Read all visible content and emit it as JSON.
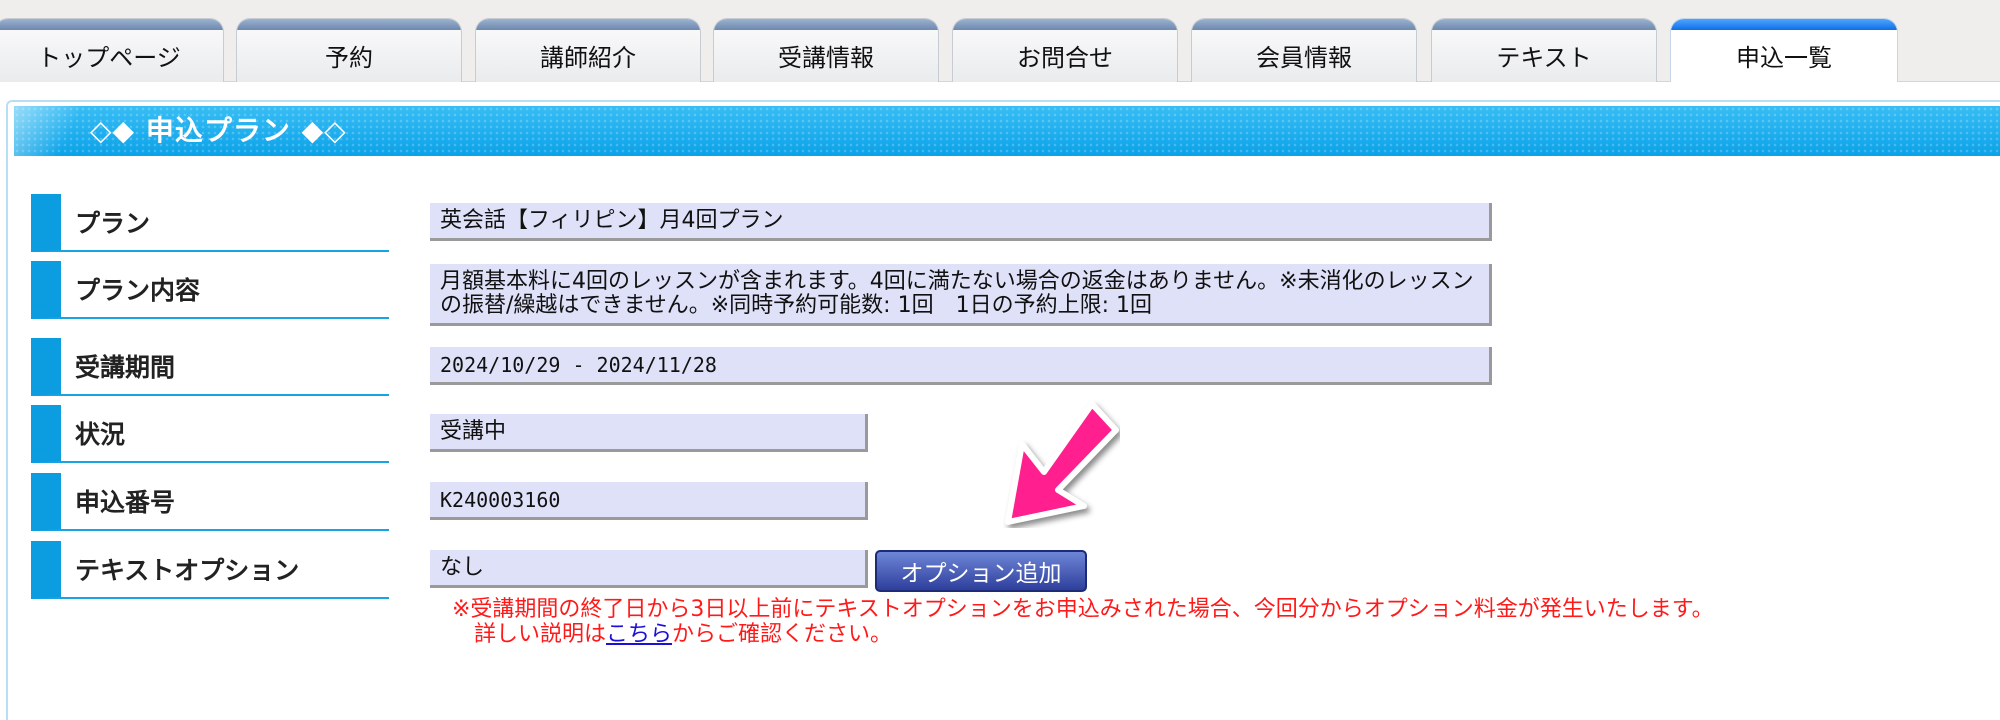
{
  "tabs": [
    {
      "label": "トップページ",
      "active": false
    },
    {
      "label": "予約",
      "active": false
    },
    {
      "label": "講師紹介",
      "active": false
    },
    {
      "label": "受講情報",
      "active": false
    },
    {
      "label": "お問合せ",
      "active": false
    },
    {
      "label": "会員情報",
      "active": false
    },
    {
      "label": "テキスト",
      "active": false
    },
    {
      "label": "申込一覧",
      "active": true
    }
  ],
  "section": {
    "title": "◇◆ 申込プラン ◆◇"
  },
  "rows": {
    "plan": {
      "label": "プラン",
      "value": "英会話【フィリピン】月4回プラン"
    },
    "plan_content": {
      "label": "プラン内容",
      "value": "月額基本料に4回のレッスンが含まれます。4回に満たない場合の返金はありません。※未消化のレッスンの振替/繰越はできません。※同時予約可能数: 1回　1日の予約上限: 1回"
    },
    "period": {
      "label": "受講期間",
      "value": "2024/10/29 - 2024/11/28"
    },
    "status": {
      "label": "状況",
      "value": "受講中"
    },
    "application_no": {
      "label": "申込番号",
      "value": "K240003160"
    },
    "text_option": {
      "label": "テキストオプション",
      "value": "なし"
    }
  },
  "option_button": {
    "label": "オプション追加"
  },
  "notice": {
    "line1": "※受講期間の終了日から3日以上前にテキストオプションをお申込みされた場合、今回分からオプション料金が発生いたします。",
    "line2_prefix": "詳しい説明は",
    "line2_link": "こちら",
    "line2_suffix": "からご確認ください。"
  },
  "arrow": {
    "icon": "pink-arrow-icon",
    "color": "#ff1f8e"
  },
  "colors": {
    "accent": "#0aa2e8",
    "label_bar": "#0b9de0",
    "value_bg": "#dfe1f8",
    "notice": "#ff1a1a",
    "button": "#3d4fb0"
  }
}
